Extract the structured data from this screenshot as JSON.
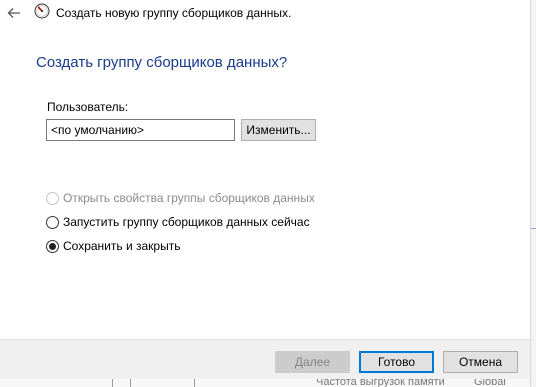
{
  "window": {
    "back_icon": "back-arrow-icon",
    "app_icon": "performance-monitor-gauge-icon",
    "title": "Создать новую группу сборщиков данных."
  },
  "main": {
    "heading": "Создать группу сборщиков данных?",
    "user_label": "Пользователь:",
    "user_value": "<по умолчанию>",
    "change_button": "Изменить..."
  },
  "options": [
    {
      "label": "Открыть свойства группы сборщиков данных",
      "selected": false,
      "enabled": false
    },
    {
      "label": "Запустить группу сборщиков данных сейчас",
      "selected": false,
      "enabled": true
    },
    {
      "label": "Сохранить и закрыть",
      "selected": true,
      "enabled": true
    }
  ],
  "footer": {
    "next_button": "Далее",
    "finish_button": "Готово",
    "cancel_button": "Отмена"
  },
  "background": {
    "text_left": "Частота выгрузок памяти",
    "text_right": "Global"
  },
  "colors": {
    "heading": "#1a3c8c",
    "default_button_border": "#0078d7",
    "disabled_text": "#8c8c8c"
  }
}
